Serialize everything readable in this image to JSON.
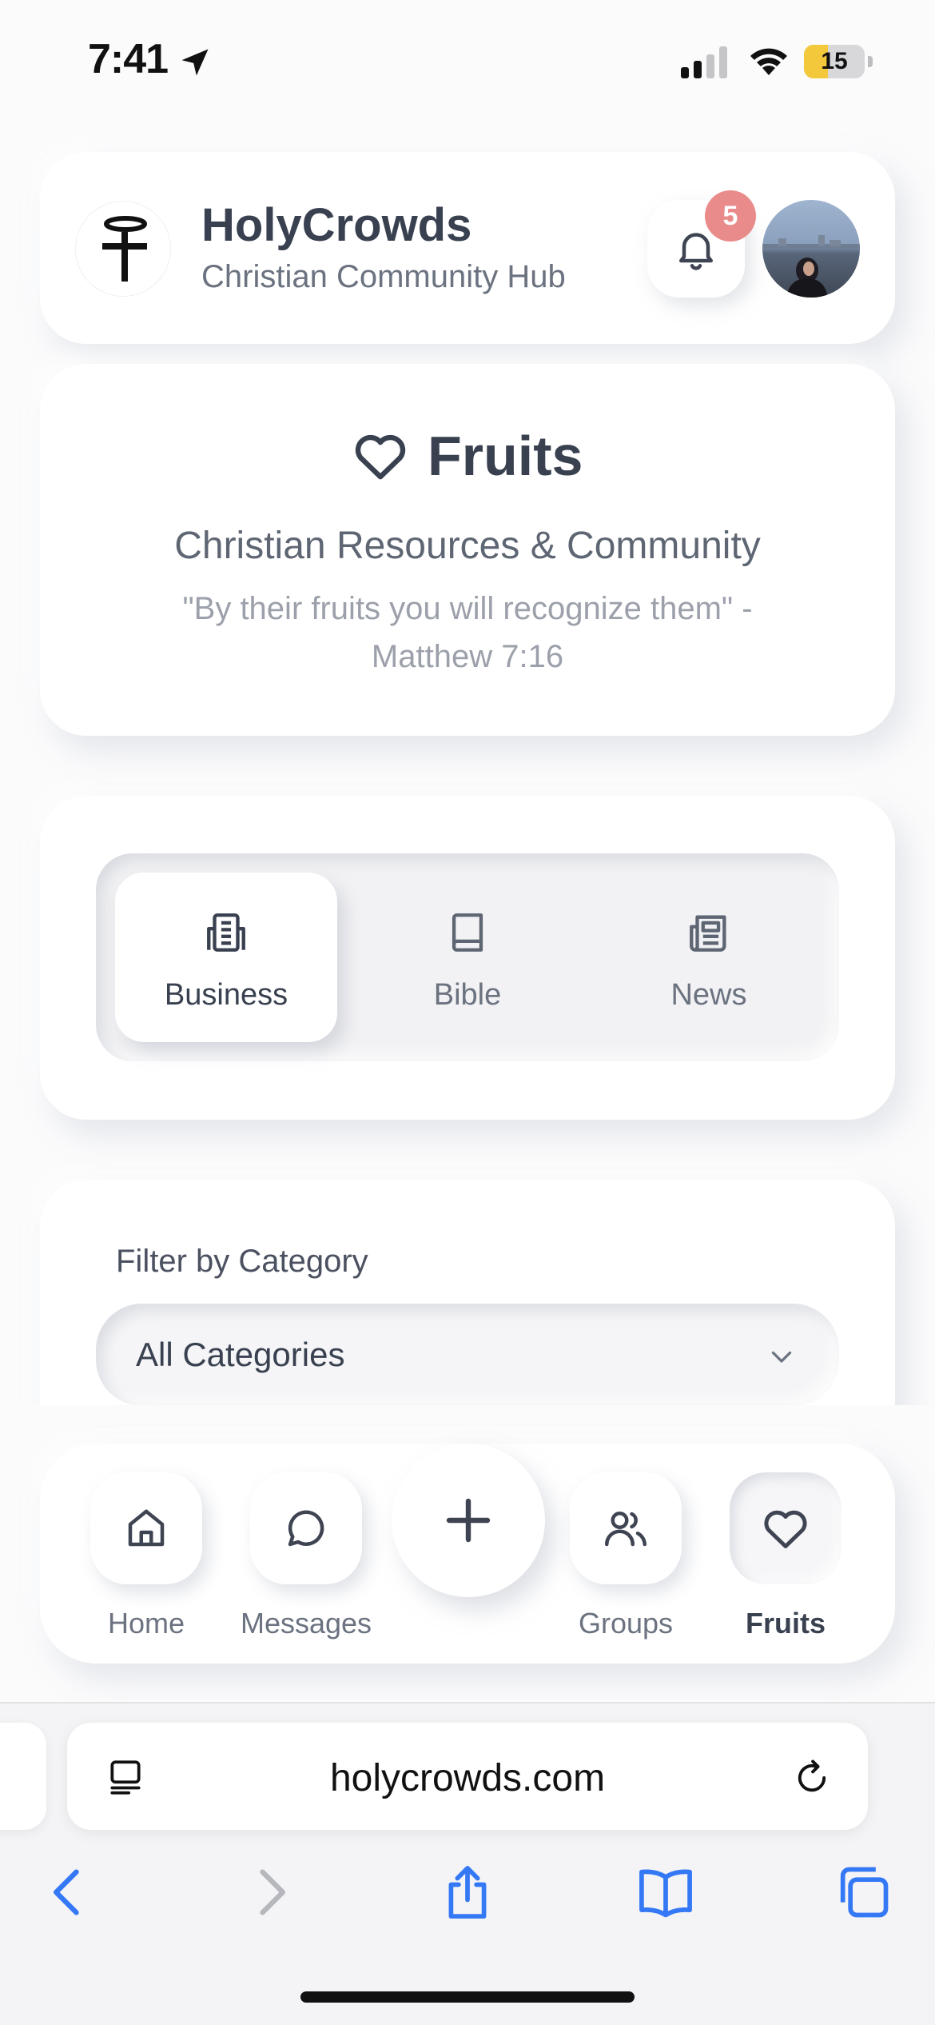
{
  "status_bar": {
    "time": "7:41",
    "battery": "15",
    "battery_level": 0.15
  },
  "header": {
    "app_name": "HolyCrowds",
    "tagline": "Christian Community Hub",
    "notification_count": "5",
    "logo_icon": "cross-halo-icon",
    "bell_icon": "bell-icon"
  },
  "fruits": {
    "title": "Fruits",
    "subtitle": "Christian Resources & Community",
    "verse": "\"By their fruits you will recognize them\" - Matthew 7:16",
    "icon": "heart-icon"
  },
  "tabs": [
    {
      "label": "Business",
      "icon": "building-icon",
      "active": true
    },
    {
      "label": "Bible",
      "icon": "book-icon",
      "active": false
    },
    {
      "label": "News",
      "icon": "newspaper-icon",
      "active": false
    }
  ],
  "filter": {
    "label": "Filter by Category",
    "selected": "All Categories"
  },
  "bottom_nav": [
    {
      "label": "Home",
      "icon": "home-icon",
      "active": false
    },
    {
      "label": "Messages",
      "icon": "chat-bubble-icon",
      "active": false
    },
    {
      "label": "Groups",
      "icon": "users-icon",
      "active": false
    },
    {
      "label": "Fruits",
      "icon": "heart-icon",
      "active": true
    }
  ],
  "browser": {
    "url": "holycrowds.com"
  },
  "colors": {
    "text_primary": "#394150",
    "text_secondary": "#6b7280",
    "badge": "#e98b8b",
    "safari_blue": "#3478f6",
    "battery_fill": "#f3c83a"
  }
}
